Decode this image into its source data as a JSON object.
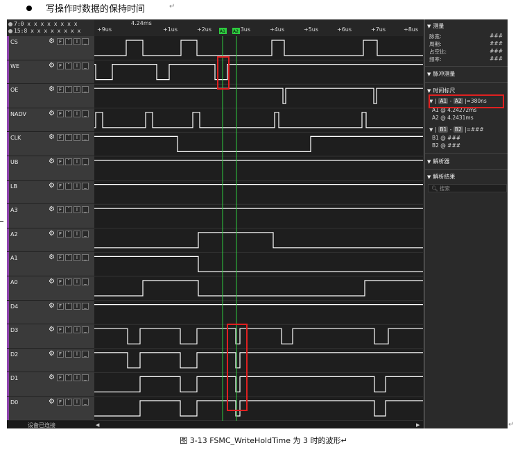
{
  "document": {
    "heading": "写操作时数据的保持时间",
    "return_mark": "↵",
    "caption": "图 3-13 FSMC_WriteHoldTime 为 3 时的波形↵"
  },
  "ruler": {
    "left_rows": [
      "7:0 x x x x x x x x",
      "15:8 x x x x x x x x"
    ],
    "top_label": "4.24ms",
    "ticks": [
      "+9us",
      "+1us",
      "+2us",
      "+3us",
      "+4us",
      "+5us",
      "+6us",
      "+7us",
      "+8us"
    ]
  },
  "cursor_flags": [
    "A1",
    "A2"
  ],
  "channels": [
    {
      "name": "CS",
      "color": "#8e44ad"
    },
    {
      "name": "WE",
      "color": "#8e44ad"
    },
    {
      "name": "OE",
      "color": "#8e44ad"
    },
    {
      "name": "NADV",
      "color": "#8e44ad"
    },
    {
      "name": "CLK",
      "color": "#8e44ad"
    },
    {
      "name": "UB",
      "color": "#8e44ad"
    },
    {
      "name": "LB",
      "color": "#8e44ad"
    },
    {
      "name": "A3",
      "color": "#8e44ad"
    },
    {
      "name": "A2",
      "color": "#8e44ad"
    },
    {
      "name": "A1",
      "color": "#8e44ad"
    },
    {
      "name": "A0",
      "color": "#8e44ad"
    },
    {
      "name": "D4",
      "color": "#8e44ad"
    },
    {
      "name": "D3",
      "color": "#8e44ad"
    },
    {
      "name": "D2",
      "color": "#8e44ad"
    },
    {
      "name": "D1",
      "color": "#8e44ad"
    },
    {
      "name": "D0",
      "color": "#8e44ad"
    }
  ],
  "channel_tools": {
    "edge": "F",
    "high": "¯",
    "low": "ⅼ",
    "line": "_"
  },
  "status_bar": {
    "device": "设备已连接"
  },
  "panel": {
    "measure": {
      "title": "测量",
      "rows": [
        {
          "label": "脉宽:",
          "value": "###"
        },
        {
          "label": "周期:",
          "value": "###"
        },
        {
          "label": "占空比:",
          "value": "###"
        },
        {
          "label": "频率:",
          "value": "###"
        }
      ]
    },
    "pulse": {
      "title": "脉冲测量"
    },
    "timing": {
      "title": "时间标尺",
      "a_diff": {
        "a1": "A1",
        "a2": "A2",
        "value": "=380ns"
      },
      "a1_line": "A1 @ 4.24272ms",
      "a2_line": "A2 @ 4.2431ms",
      "b_diff": {
        "b1": "B1",
        "b2": "B2",
        "value": "=###"
      },
      "b1_line": "B1 @ ###",
      "b2_line": "B2 @ ###"
    },
    "analyzer": {
      "title": "解析器"
    },
    "results": {
      "title": "解析结果",
      "search_placeholder": "搜索"
    }
  },
  "colors": {
    "signal": "#ffffff",
    "cursor": "#2ecc40",
    "highlight": "#e02020",
    "background": "#1e1e1e"
  }
}
